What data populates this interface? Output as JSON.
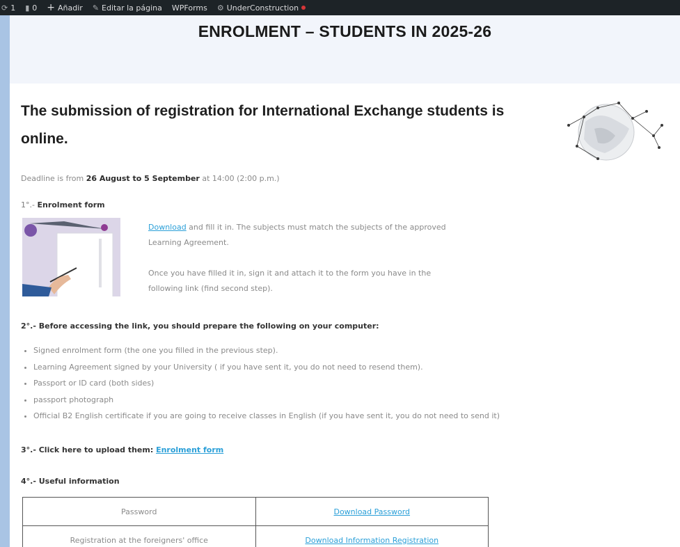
{
  "admin_bar": {
    "items": [
      {
        "icon": "refresh-icon",
        "label": "1"
      },
      {
        "icon": "comment-icon",
        "label": "0"
      },
      {
        "icon": "plus-icon",
        "label": "Añadir"
      },
      {
        "icon": "pencil-icon",
        "label": "Editar la página"
      },
      {
        "icon": "",
        "label": "WPForms"
      },
      {
        "icon": "gear-icon",
        "label": "UnderConstruction"
      }
    ],
    "status_color": "#d63638"
  },
  "page": {
    "title": "ENROLMENT – STUDENTS IN 2025-26",
    "headline": "The submission of registration for International Exchange students is online.",
    "deadline": {
      "prefix": "Deadline is from ",
      "dates": "26 August to 5 September",
      "suffix": " at 14:00 (2:00 p.m.)"
    },
    "step1": {
      "number": "1°.- ",
      "title": "Enrolment form",
      "link_label": "Download",
      "text1": " and fill it in. The subjects must match the subjects of the approved Learning Agreement.",
      "text2": "Once you have filled it in, sign it and attach it to the form you have in the following link (find second step)."
    },
    "step2": {
      "title": "2°.- Before accessing the link, you should prepare the following on your computer:",
      "items": [
        "Signed enrolment form (the one you filled in the previous step).",
        "Learning Agreement signed by your University ( if you have sent it, you do not need to resend them).",
        "Passport or ID card (both sides)",
        "passport photograph",
        "Official B2 English certificate if you are going to receive classes in English (if you have sent it, you do not need to send it)"
      ]
    },
    "step3": {
      "title": "3°.- Click here to upload them: ",
      "link_label": "Enrolment form"
    },
    "step4": {
      "title": "4°.- Useful information"
    },
    "info_table": [
      {
        "label": "Password",
        "link": "Download  Password"
      },
      {
        "label": "Registration at the foreigners' office",
        "link": "Download  Information  Registration"
      }
    ],
    "link_color": "#2a9fd8"
  }
}
